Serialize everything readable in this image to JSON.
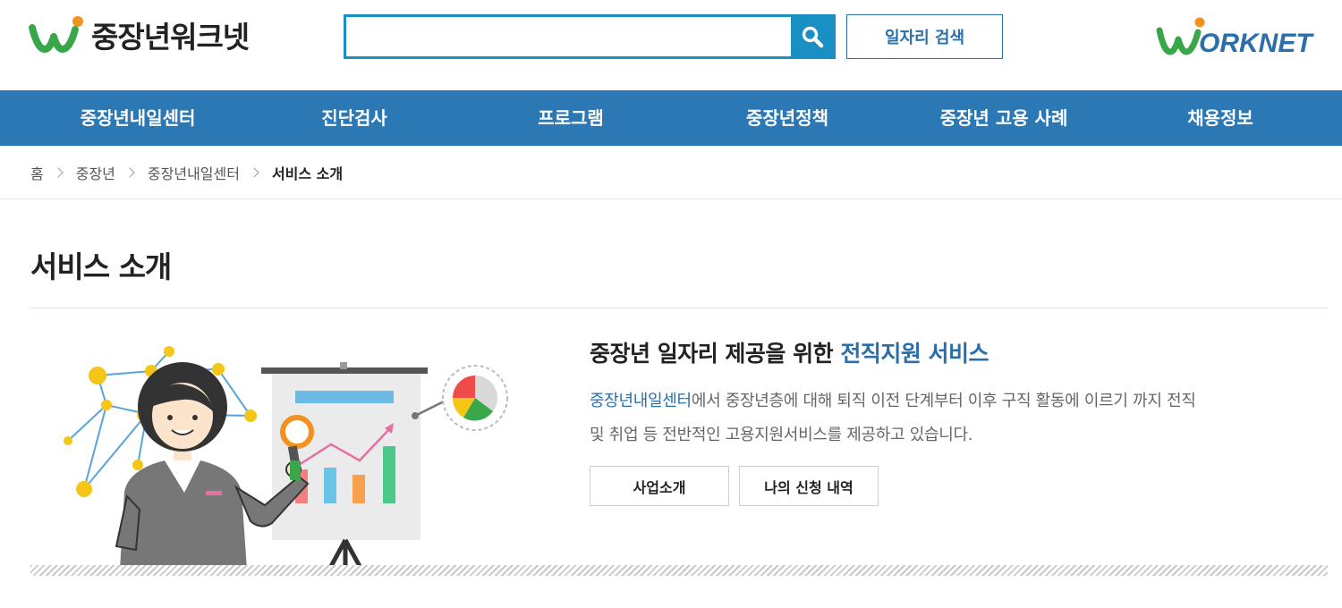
{
  "header": {
    "logo_text": "중장년워크넷",
    "search_placeholder": "",
    "search_value": "",
    "job_search_label": "일자리 검색",
    "worknet_logo_text": "WORKNET"
  },
  "nav": {
    "items": [
      {
        "label": "중장년내일센터"
      },
      {
        "label": "진단검사"
      },
      {
        "label": "프로그램"
      },
      {
        "label": "중장년정책"
      },
      {
        "label": "중장년 고용 사례"
      },
      {
        "label": "채용정보"
      }
    ]
  },
  "breadcrumb": {
    "items": [
      {
        "label": "홈"
      },
      {
        "label": "중장년"
      },
      {
        "label": "중장년내일센터"
      },
      {
        "label": "서비스 소개"
      }
    ]
  },
  "page": {
    "title": "서비스 소개"
  },
  "intro": {
    "heading_prefix": "중장년 일자리 제공을 위한 ",
    "heading_accent": "전직지원 서비스",
    "desc_link": "중장년내일센터",
    "desc_line1_rest": "에서 중장년층에 대해 퇴직 이전 단계부터 이후 구직 활동에 이르기 까지 전직",
    "desc_line2": "및 취업 등 전반적인 고용지원서비스를 제공하고 있습니다."
  },
  "buttons": {
    "business_intro": "사업소개",
    "my_applications": "나의 신청 내역"
  },
  "colors": {
    "brand_blue": "#2b78b5",
    "search_blue": "#1a8fc3",
    "accent_text": "#2b6eaa",
    "logo_green": "#3aa64a",
    "logo_orange": "#f29220"
  }
}
